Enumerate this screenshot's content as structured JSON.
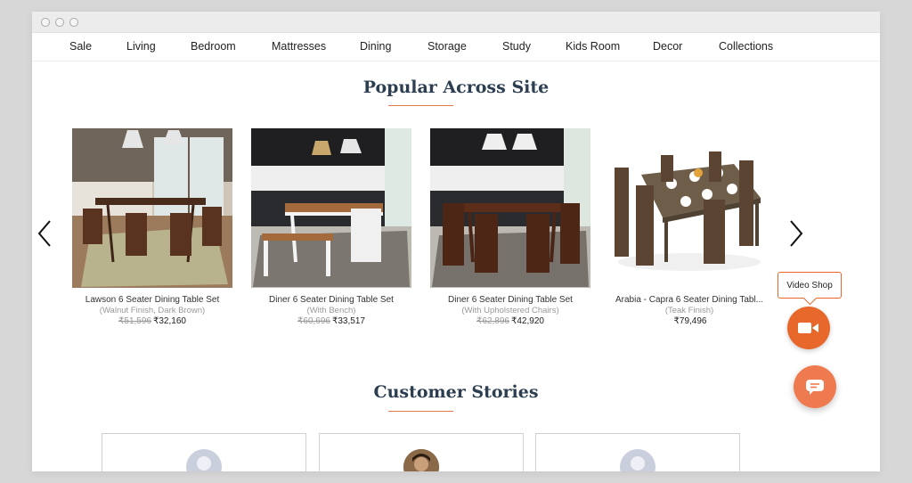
{
  "nav": {
    "items": [
      "Sale",
      "Living",
      "Bedroom",
      "Mattresses",
      "Dining",
      "Storage",
      "Study",
      "Kids Room",
      "Decor",
      "Collections"
    ]
  },
  "popular": {
    "title": "Popular Across Site",
    "products": [
      {
        "name": "Lawson 6 Seater Dining Table Set",
        "variant": "(Walnut Finish, Dark Brown)",
        "mrp": "₹51,596",
        "price": "₹32,160"
      },
      {
        "name": "Diner 6 Seater Dining Table Set",
        "variant": "(With Bench)",
        "mrp": "₹60,696",
        "price": "₹33,517"
      },
      {
        "name": "Diner 6 Seater Dining Table Set",
        "variant": "(With Upholstered Chairs)",
        "mrp": "₹62,896",
        "price": "₹42,920"
      },
      {
        "name": "Arabia - Capra 6 Seater Dining Tabl...",
        "variant": "(Teak Finish)",
        "mrp": "",
        "price": "₹79,496"
      }
    ]
  },
  "stories": {
    "title": "Customer Stories"
  },
  "widgets": {
    "video_label": "Video Shop"
  },
  "icons": {
    "prev": "chevron-left-icon",
    "next": "chevron-right-icon",
    "video": "video-camera-icon",
    "chat": "chat-icon"
  },
  "colors": {
    "accent": "#e8672a",
    "title": "#2c3e50"
  }
}
